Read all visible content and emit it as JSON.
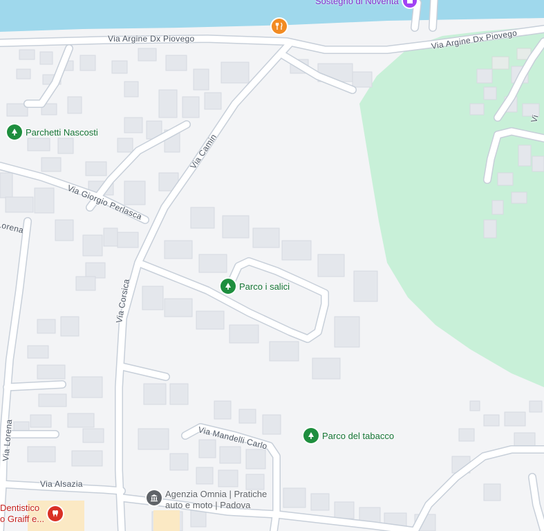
{
  "colors": {
    "background": "#f3f4f6",
    "water": "#9fd8ec",
    "park": "#c8f0d8",
    "road": "#ffffff",
    "road_casing": "#c7cfd9",
    "building": "#e4e7ec",
    "park_pin": "#1e8e3e",
    "restaurant_pin": "#f28b22",
    "landmark_pin": "#a142f4",
    "business_pin": "#5f6368",
    "dentist_pin": "#d93025"
  },
  "roads": {
    "argine_left": "Via Argine Dx Piovego",
    "argine_right": "Via Argine Dx Piovego",
    "camin": "Via Camin",
    "perlasca": "Via Giorgio Perlasca",
    "corsica": "Via Corsica",
    "lorena_top": "Lorena",
    "lorena": "Via Lorena",
    "mandelli": "Via Mandelli Carlo",
    "alsazia": "Via Alsazia",
    "right_edge": "Vi"
  },
  "places": {
    "landmark_top": "Sostegno di Noventa",
    "parchetti": "Parchetti Nascosti",
    "salici": "Parco i salici",
    "tabacco": "Parco del tabacco",
    "agenzia_line1": "Agenzia Omnia | Pratiche",
    "agenzia_line2": "auto e moto | Padova",
    "dentist_line1": "Dentistico",
    "dentist_line2": "o Graiff e..."
  },
  "icons": {
    "park": "tree-icon",
    "restaurant": "fork-knife-icon",
    "landmark": "landmark-icon",
    "business": "building-icon",
    "dentist": "tooth-icon"
  }
}
